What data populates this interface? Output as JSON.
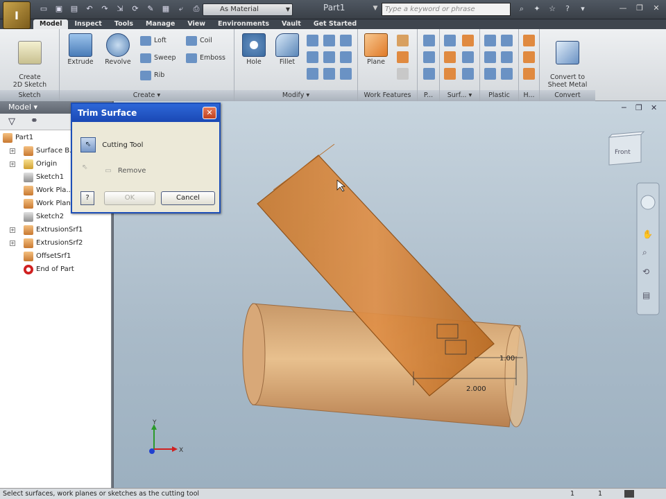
{
  "titlebar": {
    "app_button": "I",
    "material": "As Material",
    "document": "Part1",
    "search_placeholder": "Type a keyword or phrase"
  },
  "tabs": [
    "Model",
    "Inspect",
    "Tools",
    "Manage",
    "View",
    "Environments",
    "Vault",
    "Get Started"
  ],
  "ribbon": {
    "sketch": {
      "create_sketch": "Create\n2D Sketch",
      "label": "Sketch"
    },
    "create": {
      "extrude": "Extrude",
      "revolve": "Revolve",
      "loft": "Loft",
      "sweep": "Sweep",
      "rib": "Rib",
      "coil": "Coil",
      "emboss": "Emboss",
      "label": "Create"
    },
    "modify": {
      "hole": "Hole",
      "fillet": "Fillet",
      "label": "Modify"
    },
    "work_features": {
      "plane": "Plane",
      "label": "Work Features"
    },
    "pattern_label": "P...",
    "surface_label": "Surf...",
    "plastic_label": "Plastic",
    "harness_label": "H...",
    "convert": {
      "button": "Convert to\nSheet Metal",
      "label": "Convert"
    }
  },
  "browser": {
    "header": "Model",
    "items": [
      {
        "label": "Part1"
      },
      {
        "label": "Surface B..."
      },
      {
        "label": "Origin"
      },
      {
        "label": "Sketch1"
      },
      {
        "label": "Work Pla..."
      },
      {
        "label": "Work Plane2"
      },
      {
        "label": "Sketch2"
      },
      {
        "label": "ExtrusionSrf1"
      },
      {
        "label": "ExtrusionSrf2"
      },
      {
        "label": "OffsetSrf1"
      },
      {
        "label": "End of Part"
      }
    ]
  },
  "dialog": {
    "title": "Trim Surface",
    "cutting_tool": "Cutting Tool",
    "remove": "Remove",
    "ok": "OK",
    "cancel": "Cancel"
  },
  "viewport": {
    "dim1": "1.00",
    "dim2": "2.000",
    "viewcube": "Front",
    "axis_x": "X",
    "axis_y": "Y"
  },
  "statusbar": {
    "message": "Select surfaces, work planes or sketches as the cutting tool",
    "n1": "1",
    "n2": "1"
  }
}
